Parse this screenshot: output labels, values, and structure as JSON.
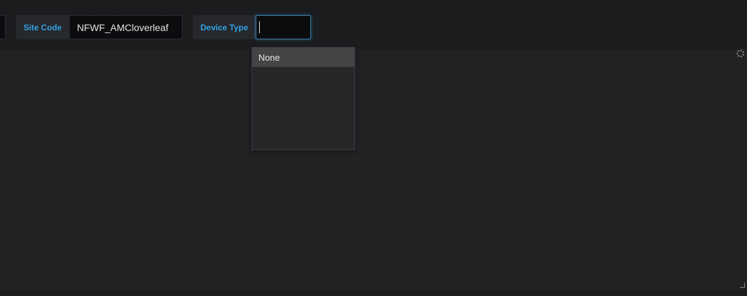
{
  "filters": {
    "site_code": {
      "label": "Site Code",
      "value": "NFWF_AMCloverleaf"
    },
    "device_type": {
      "label": "Device Type",
      "value": ""
    }
  },
  "dropdown": {
    "options": [
      {
        "label": "None",
        "highlighted": true
      }
    ]
  },
  "colors": {
    "label_accent": "#33a2e5",
    "background": "#212224",
    "input_background": "#0b0c0e",
    "option_highlight": "#434446"
  },
  "icons": {
    "loading": "spinner-icon",
    "resize": "resize-handle-icon"
  }
}
